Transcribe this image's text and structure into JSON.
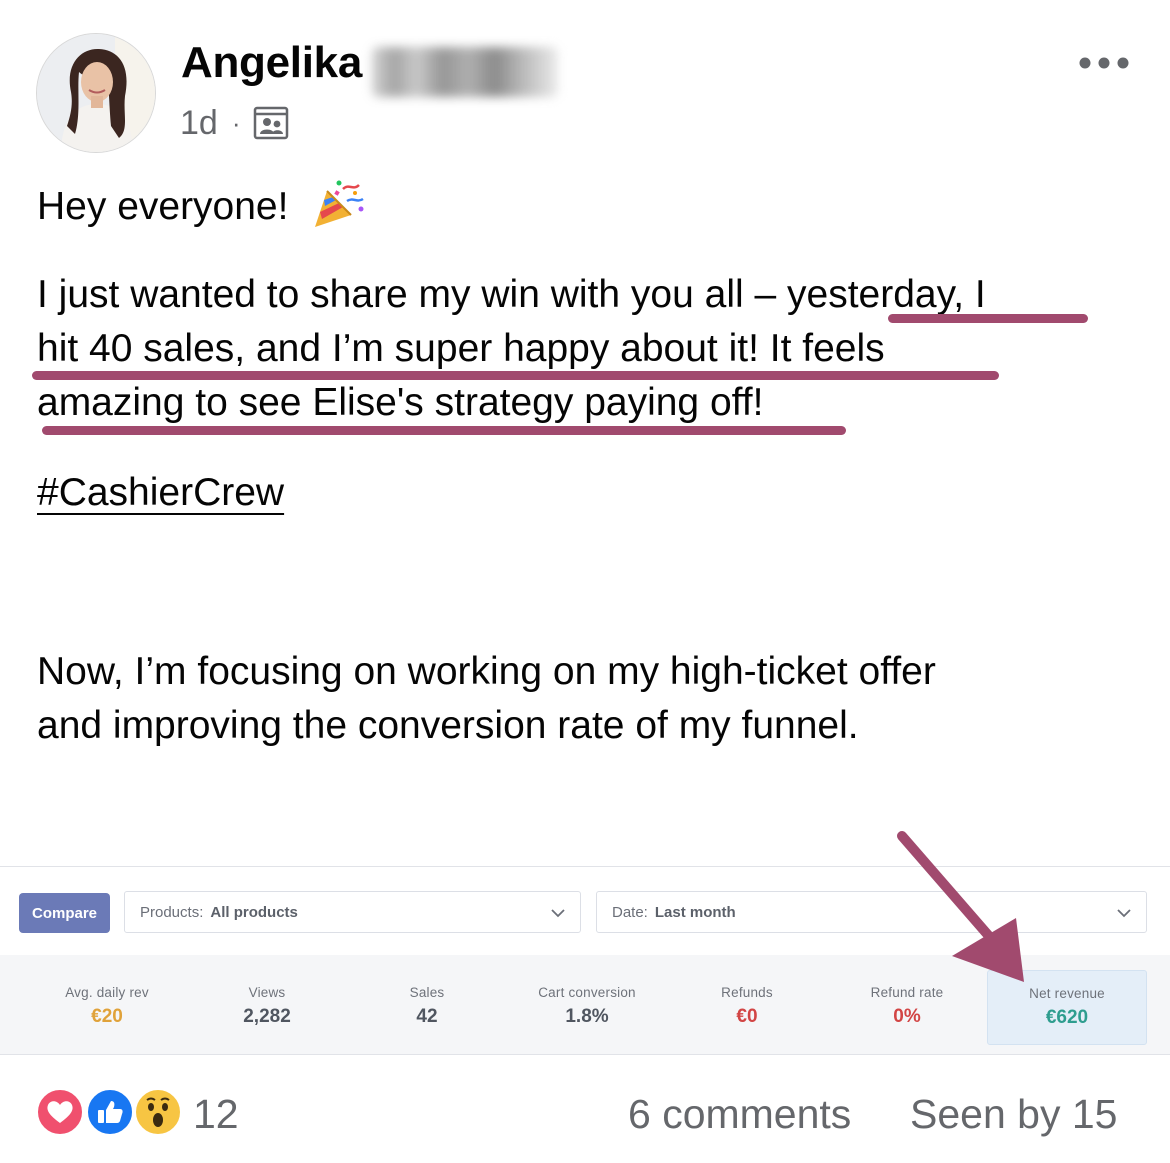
{
  "post": {
    "author_name": "Angelika",
    "time": "1d",
    "separator": "·",
    "audience_icon": "group-icon",
    "greeting": "Hey everyone!",
    "celebration_emoji": "party-popper",
    "paragraph1_line1": "I just wanted to share my win with you all – yesterday, I",
    "paragraph1_line2": "hit 40 sales, and I’m super happy about it! It feels",
    "paragraph1_line3": "amazing to see Elise's strategy paying off!",
    "hashtag": "#CashierCrew",
    "paragraph2_line1": "Now, I’m focusing on working on my high-ticket offer",
    "paragraph2_line2": "and improving the conversion rate of my funnel.",
    "highlight_color": "#a14a6e"
  },
  "dashboard": {
    "compare_label": "Compare",
    "products_filter": {
      "label": "Products:",
      "value": "All products"
    },
    "date_filter": {
      "label": "Date:",
      "value": "Last month"
    },
    "stats": [
      {
        "label": "Avg. daily rev",
        "value": "€20",
        "color": "#e0a23a"
      },
      {
        "label": "Views",
        "value": "2,282",
        "color": "#505660"
      },
      {
        "label": "Sales",
        "value": "42",
        "color": "#505660"
      },
      {
        "label": "Cart conversion",
        "value": "1.8%",
        "color": "#505660"
      },
      {
        "label": "Refunds",
        "value": "€0",
        "color": "#d24545"
      },
      {
        "label": "Refund rate",
        "value": "0%",
        "color": "#d24545"
      },
      {
        "label": "Net revenue",
        "value": "€620",
        "color": "#2e9d8f"
      }
    ]
  },
  "footer": {
    "reaction_icons": [
      "love-icon",
      "like-icon",
      "wow-icon"
    ],
    "reaction_count": "12",
    "comments": "6 comments",
    "seen": "Seen by 15"
  }
}
